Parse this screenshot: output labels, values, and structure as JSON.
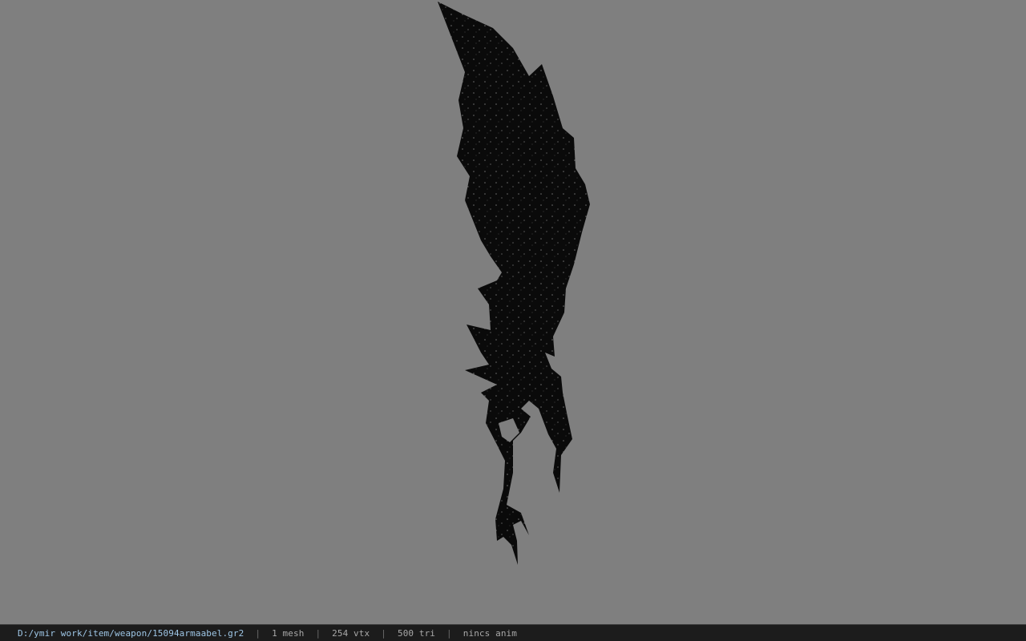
{
  "viewer": {
    "background_color": "#7f7f7f",
    "model_color": "#0a0a0a",
    "model_icon": "sword-model"
  },
  "status": {
    "path": "D:/ymir work/item/weapon/15094armaabel.gr2",
    "separator": "|",
    "mesh": "1 mesh",
    "vtx": "254 vtx",
    "tri": "500 tri",
    "anim": "nincs anim"
  }
}
